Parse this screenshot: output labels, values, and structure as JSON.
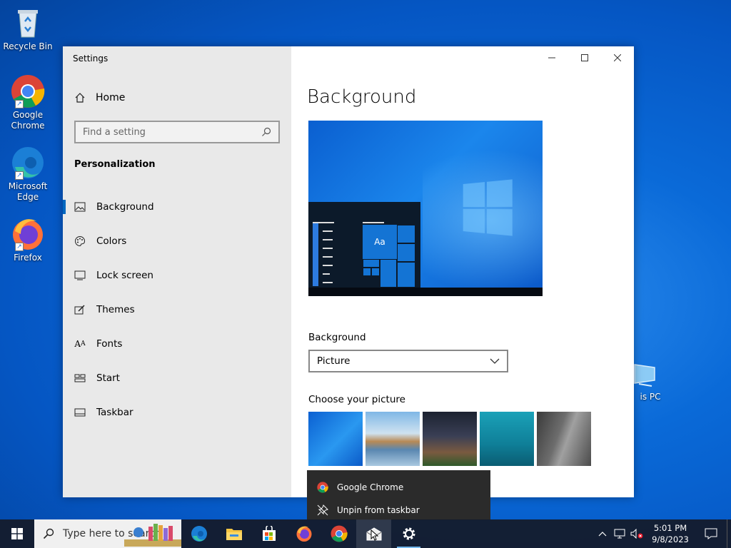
{
  "desktop": {
    "icons": [
      {
        "label": "Recycle Bin"
      },
      {
        "label": "Google Chrome"
      },
      {
        "label": "Microsoft Edge"
      },
      {
        "label": "Firefox"
      }
    ],
    "partial_icon_label": "is PC"
  },
  "settings": {
    "app_title": "Settings",
    "home_label": "Home",
    "search_placeholder": "Find a setting",
    "section_title": "Personalization",
    "nav": [
      {
        "label": "Background",
        "icon": "picture-icon",
        "active": true
      },
      {
        "label": "Colors",
        "icon": "palette-icon"
      },
      {
        "label": "Lock screen",
        "icon": "lock-screen-icon"
      },
      {
        "label": "Themes",
        "icon": "themes-icon"
      },
      {
        "label": "Fonts",
        "icon": "fonts-icon"
      },
      {
        "label": "Start",
        "icon": "start-icon"
      },
      {
        "label": "Taskbar",
        "icon": "taskbar-icon"
      }
    ],
    "page_title": "Background",
    "preview_tile_text": "Aa",
    "background_label": "Background",
    "background_value": "Picture",
    "choose_label": "Choose your picture"
  },
  "jumplist": {
    "items": [
      {
        "label": "Google Chrome",
        "icon": "chrome-icon"
      },
      {
        "label": "Unpin from taskbar",
        "icon": "unpin-icon"
      }
    ]
  },
  "taskbar": {
    "search_placeholder": "Type here to search",
    "clock_time": "5:01 PM",
    "clock_date": "9/8/2023"
  },
  "colors": {
    "accent": "#0067c0",
    "taskbar": "#141c2e",
    "sidebar": "#e9e9e9"
  }
}
